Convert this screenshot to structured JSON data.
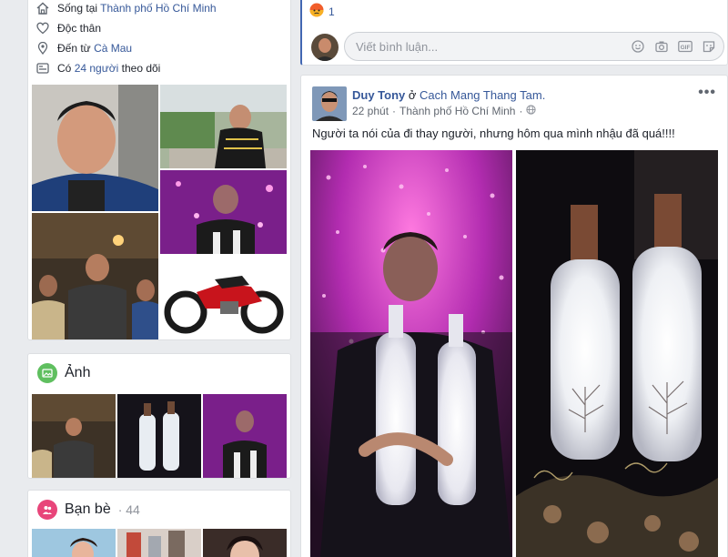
{
  "intro": {
    "lives_prefix": "Sống tại",
    "lives_city": "Thành phố Hồ Chí Minh",
    "relationship": "Độc thân",
    "from_prefix": "Đến từ",
    "from_city": "Cà Mau",
    "followers_prefix": "Có",
    "followers_link": "24 người",
    "followers_suffix": "theo dõi"
  },
  "photos_section": {
    "title": "Ảnh"
  },
  "friends_section": {
    "title": "Bạn bè",
    "count": "· 44"
  },
  "reactions": {
    "angry_count": "1"
  },
  "comment": {
    "placeholder": "Viết bình luận..."
  },
  "post": {
    "author": "Duy Tony",
    "at": "ở",
    "location": "Cach Mang Thang Tam.",
    "time": "22 phút",
    "place": "Thành phố Hồ Chí Minh",
    "text": "Người ta nói của đi thay người, nhưng hôm qua mình nhậu đã quá!!!!",
    "menu": "•••"
  },
  "colors": {
    "link": "#365899",
    "fb_blue": "#4267b2",
    "background": "#e9ebee",
    "photos_icon": "#5fbf5f",
    "friends_icon": "#e8457a"
  },
  "icons": [
    "home-icon",
    "heart-icon",
    "location-pin-icon",
    "followers-icon",
    "photos-icon",
    "friends-icon",
    "angry-reaction-icon",
    "emoji-icon",
    "camera-icon",
    "gif-icon",
    "sticker-icon",
    "globe-icon",
    "more-icon"
  ]
}
